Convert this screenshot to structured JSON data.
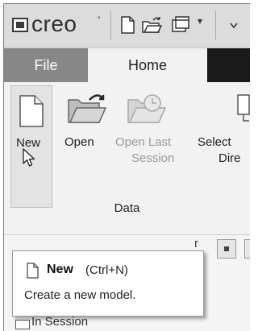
{
  "app": {
    "logo_text": "creo",
    "logo_mark": "°"
  },
  "quick_access": {
    "icons": [
      "new-document-icon",
      "open-folder-icon",
      "window-icon"
    ],
    "dropdown": "▾"
  },
  "tabs": [
    {
      "label": "File",
      "active": false
    },
    {
      "label": "Home",
      "active": true
    }
  ],
  "ribbon": {
    "buttons": [
      {
        "label": "New",
        "icon": "new-document-icon",
        "enabled": true
      },
      {
        "label": "Open",
        "icon": "open-folder-icon",
        "enabled": true
      },
      {
        "label_line1": "Open Last",
        "label_line2": "Session",
        "icon": "open-last-session-icon",
        "enabled": false
      },
      {
        "label_line1": "Select",
        "label_line2": "Dire",
        "icon": "select-directory-icon",
        "enabled": true
      }
    ],
    "group_label": "Data"
  },
  "lower": {
    "stub_label": "r",
    "tree_item": "In Session"
  },
  "tooltip": {
    "title": "New",
    "shortcut": "(Ctrl+N)",
    "description": "Create a new model."
  },
  "colors": {
    "tab_bar": "#7e7e7e",
    "tab_file": "#878787",
    "tab_dark": "#1a1a1a",
    "ribbon_bg": "#f2f2f2",
    "disabled_text": "#9a9a9a"
  }
}
